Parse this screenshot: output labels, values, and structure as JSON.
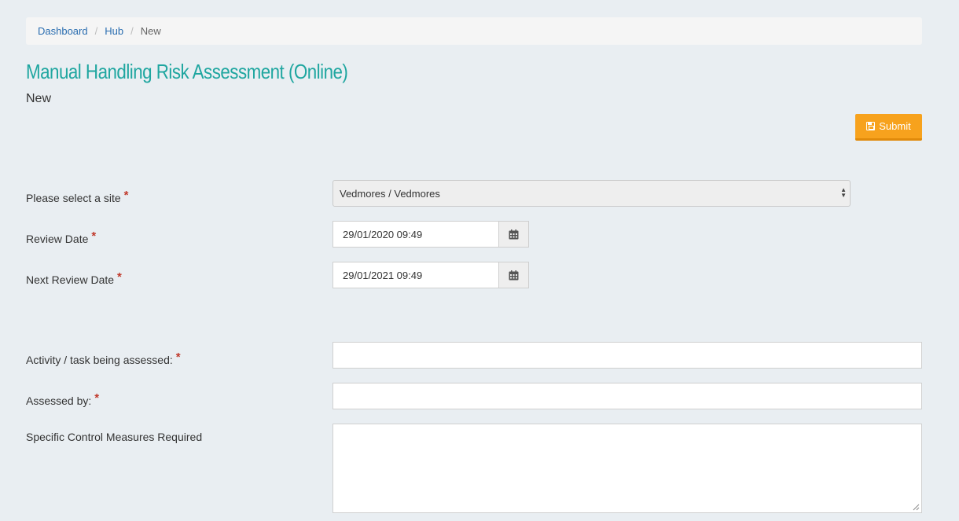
{
  "breadcrumb": {
    "items": [
      "Dashboard",
      "Hub"
    ],
    "current": "New"
  },
  "page": {
    "title": "Manual Handling Risk Assessment (Online)",
    "subtitle": "New"
  },
  "toolbar": {
    "submit_label": "Submit",
    "submit_icon": "save-icon",
    "accent_color": "#f7a21d"
  },
  "form": {
    "required_marker": "*",
    "site": {
      "label": "Please select a site",
      "value": "Vedmores / Vedmores"
    },
    "review_date": {
      "label": "Review Date",
      "value": "29/01/2020 09:49",
      "icon": "calendar-icon"
    },
    "next_review_date": {
      "label": "Next Review Date",
      "value": "29/01/2021 09:49",
      "icon": "calendar-icon"
    },
    "activity": {
      "label": "Activity / task being assessed:",
      "value": ""
    },
    "assessed_by": {
      "label": "Assessed by:",
      "value": ""
    },
    "control_measures": {
      "label": "Specific Control Measures Required",
      "value": ""
    }
  },
  "colors": {
    "title": "#1fa6a0",
    "link": "#2a6db0",
    "required": "#c0392b",
    "background": "#e9eef2"
  }
}
